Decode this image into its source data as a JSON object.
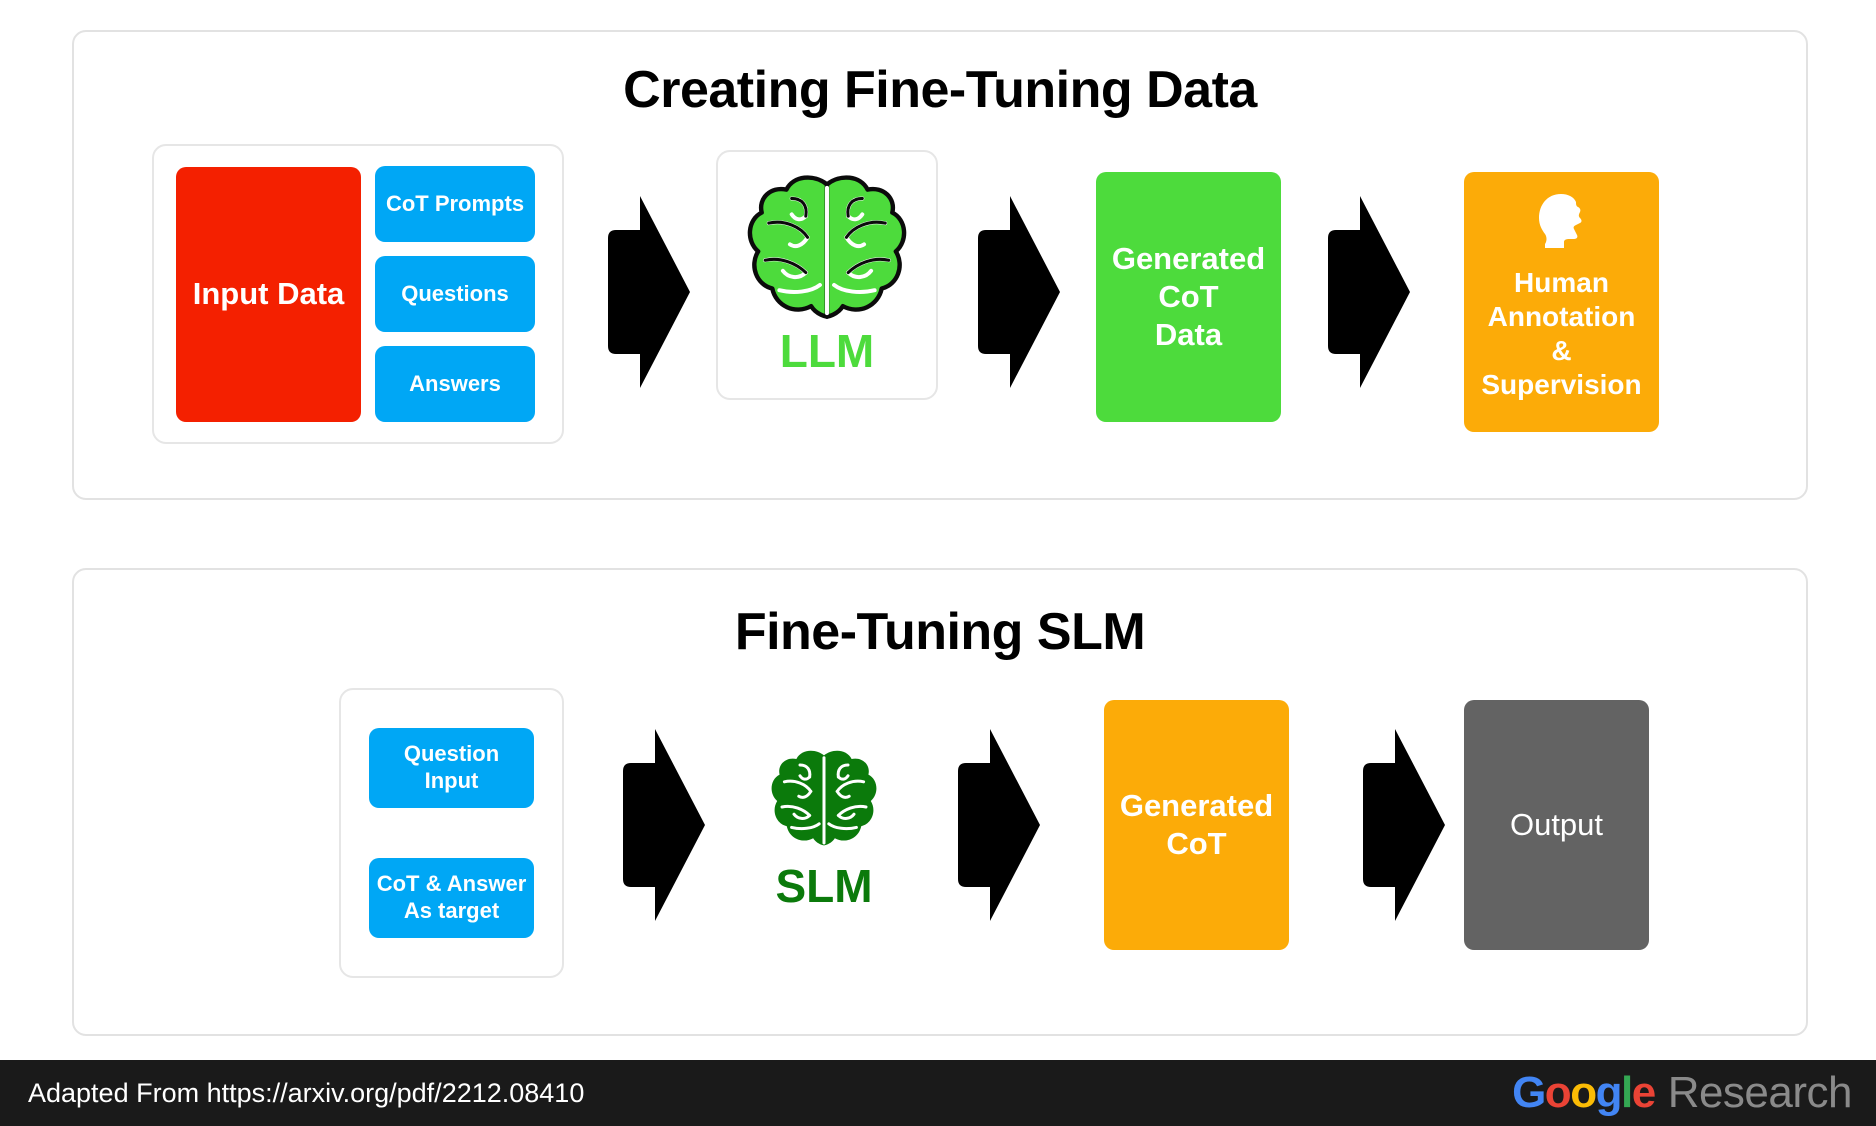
{
  "panels": {
    "creating": {
      "title": "Creating Fine-Tuning Data",
      "input_group": {
        "main_block": "Input Data",
        "items": [
          "CoT Prompts",
          "Questions",
          "Answers"
        ]
      },
      "model_card": {
        "label": "LLM",
        "icon": "brain-icon",
        "color": "#4ddb3c"
      },
      "generated_block": "Generated\nCoT\nData",
      "generated_lines": [
        "Generated",
        "CoT",
        "Data"
      ],
      "human_block": {
        "icon": "head-silhouette-icon",
        "lines": [
          "Human",
          "Annotation",
          "&",
          "Supervision"
        ]
      }
    },
    "finetune": {
      "title": "Fine-Tuning SLM",
      "input_group": {
        "items": [
          [
            "Question",
            "Input"
          ],
          [
            "CoT & Answer",
            "As target"
          ]
        ]
      },
      "model_card": {
        "label": "SLM",
        "icon": "brain-icon",
        "color": "#0b7a0b"
      },
      "generated_lines": [
        "Generated",
        "CoT"
      ],
      "output_block": "Output"
    }
  },
  "arrows": {
    "icon": "thick-right-arrow-icon",
    "color": "#000000"
  },
  "footer": {
    "attribution": "Adapted From https://arxiv.org/pdf/2212.08410",
    "logo": {
      "letters": [
        {
          "char": "G",
          "color": "#4285f4"
        },
        {
          "char": "o",
          "color": "#ea4335"
        },
        {
          "char": "o",
          "color": "#fbbc05"
        },
        {
          "char": "g",
          "color": "#4285f4"
        },
        {
          "char": "l",
          "color": "#34a853"
        },
        {
          "char": "e",
          "color": "#ea4335"
        }
      ],
      "suffix": "Research"
    }
  },
  "colors": {
    "red": "#f42000",
    "blue": "#00a7f5",
    "green_light": "#4ddb3c",
    "green_dark": "#0b7a0b",
    "orange": "#fcab08",
    "grey": "#636363",
    "footer_bg": "#1a1a1a",
    "panel_border": "#e2e2e2"
  }
}
